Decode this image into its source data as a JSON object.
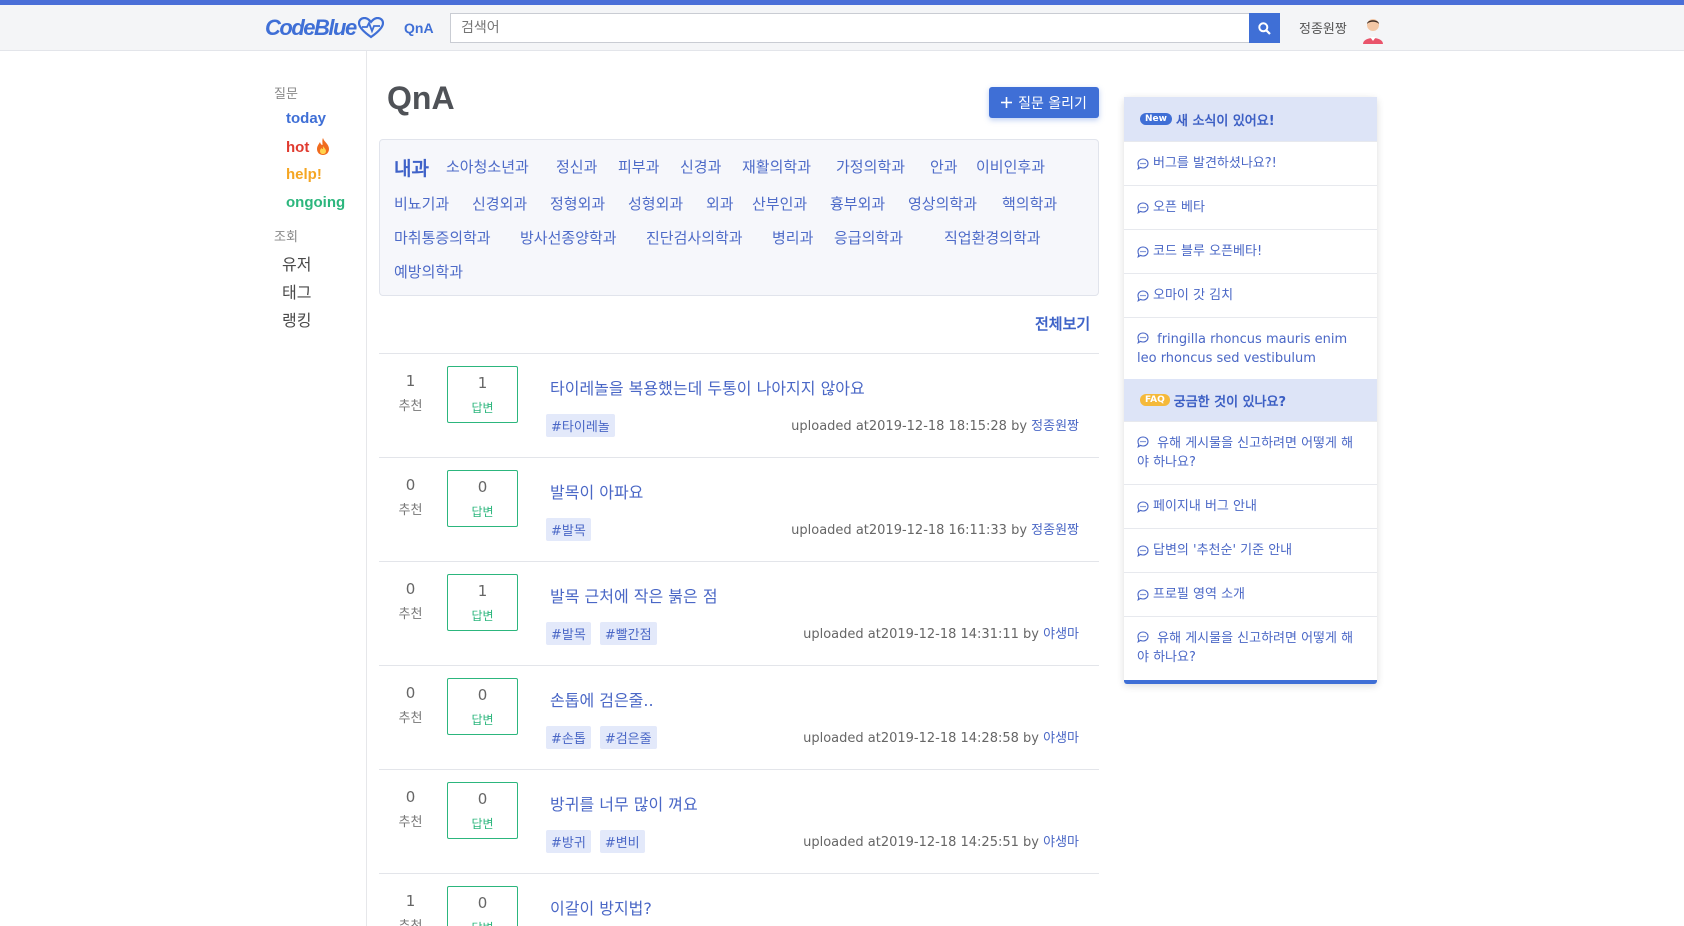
{
  "header": {
    "logo": "CodeBlue",
    "nav_qna": "QnA",
    "search_placeholder": "검색어",
    "username": "정종원짱"
  },
  "sidebar": {
    "questions_heading": "질문",
    "filters": [
      {
        "label": "today",
        "color": "#3f6fd6"
      },
      {
        "label": "hot",
        "color": "#e03a2f"
      },
      {
        "label": "help!",
        "color": "#f5a623"
      },
      {
        "label": "ongoing",
        "color": "#2cb67d"
      }
    ],
    "browse_heading": "조회",
    "links": [
      "유저",
      "태그",
      "랭킹"
    ]
  },
  "main": {
    "title": "QnA",
    "ask_button": "질문 올리기",
    "view_all": "전체보기",
    "departments": [
      "내과",
      "소아청소년과",
      "정신과",
      "피부과",
      "신경과",
      "재활의학과",
      "가정의학과",
      "안과",
      "이비인후과",
      "비뇨기과",
      "신경외과",
      "정형외과",
      "성형외과",
      "외과",
      "산부인과",
      "흉부외과",
      "영상의학과",
      "핵의학과",
      "마취통증의학과",
      "방사선종양학과",
      "진단검사의학과",
      "병리과",
      "응급의학과",
      "직업환경의학과",
      "예방의학과"
    ],
    "vote_label": "추천",
    "answer_label": "답변",
    "questions": [
      {
        "votes": "1",
        "answers": "1",
        "title": "타이레놀을 복용했는데 두통이 나아지지 않아요",
        "tags": [
          "#타이레놀"
        ],
        "uploaded": "uploaded at2019-12-18 18:15:28 by ",
        "author": "정종원짱"
      },
      {
        "votes": "0",
        "answers": "0",
        "title": "발목이 아파요",
        "tags": [
          "#발목"
        ],
        "uploaded": "uploaded at2019-12-18 16:11:33 by ",
        "author": "정종원짱"
      },
      {
        "votes": "0",
        "answers": "1",
        "title": "발목 근처에 작은 붉은 점",
        "tags": [
          "#발목",
          "#빨간점"
        ],
        "uploaded": "uploaded at2019-12-18 14:31:11 by ",
        "author": "야생마"
      },
      {
        "votes": "0",
        "answers": "0",
        "title": "손톱에 검은줄..",
        "tags": [
          "#손톱",
          "#검은줄"
        ],
        "uploaded": "uploaded at2019-12-18 14:28:58 by ",
        "author": "야생마"
      },
      {
        "votes": "0",
        "answers": "0",
        "title": "방귀를 너무 많이 껴요",
        "tags": [
          "#방귀",
          "#변비"
        ],
        "uploaded": "uploaded at2019-12-18 14:25:51 by ",
        "author": "야생마"
      },
      {
        "votes": "1",
        "answers": "0",
        "title": "이갈이 방지법?",
        "tags": [],
        "uploaded": "",
        "author": ""
      }
    ]
  },
  "news_panel": {
    "new_badge": "New",
    "new_heading": "새 소식이 있어요!",
    "new_items": [
      "버그를 발견하셨나요?!",
      "오픈 베타",
      "코드 블루 오픈베타!",
      "오마이 갓 김치",
      "fringilla rhoncus mauris enim leo rhoncus sed vestibulum"
    ],
    "faq_badge": "FAQ",
    "faq_heading": "궁금한 것이 있나요?",
    "faq_items": [
      "유해 게시물을 신고하려면 어떻게 해야 하나요?",
      "페이지내 버그 안내",
      "답변의 '추천순' 기준 안내",
      "프로필 영역 소개",
      "유해 게시물을 신고하려면 어떻게 해야 하나요?"
    ],
    "colors": {
      "new_badge": "#3f6fd6",
      "faq_badge": "#f5b93a"
    }
  }
}
